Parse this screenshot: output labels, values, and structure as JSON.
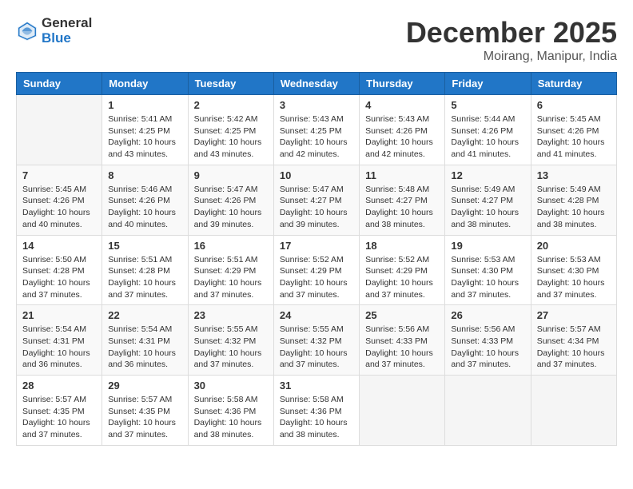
{
  "header": {
    "logo_line1": "General",
    "logo_line2": "Blue",
    "month": "December 2025",
    "location": "Moirang, Manipur, India"
  },
  "weekdays": [
    "Sunday",
    "Monday",
    "Tuesday",
    "Wednesday",
    "Thursday",
    "Friday",
    "Saturday"
  ],
  "weeks": [
    [
      {
        "day": "",
        "info": ""
      },
      {
        "day": "1",
        "info": "Sunrise: 5:41 AM\nSunset: 4:25 PM\nDaylight: 10 hours\nand 43 minutes."
      },
      {
        "day": "2",
        "info": "Sunrise: 5:42 AM\nSunset: 4:25 PM\nDaylight: 10 hours\nand 43 minutes."
      },
      {
        "day": "3",
        "info": "Sunrise: 5:43 AM\nSunset: 4:25 PM\nDaylight: 10 hours\nand 42 minutes."
      },
      {
        "day": "4",
        "info": "Sunrise: 5:43 AM\nSunset: 4:26 PM\nDaylight: 10 hours\nand 42 minutes."
      },
      {
        "day": "5",
        "info": "Sunrise: 5:44 AM\nSunset: 4:26 PM\nDaylight: 10 hours\nand 41 minutes."
      },
      {
        "day": "6",
        "info": "Sunrise: 5:45 AM\nSunset: 4:26 PM\nDaylight: 10 hours\nand 41 minutes."
      }
    ],
    [
      {
        "day": "7",
        "info": "Sunrise: 5:45 AM\nSunset: 4:26 PM\nDaylight: 10 hours\nand 40 minutes."
      },
      {
        "day": "8",
        "info": "Sunrise: 5:46 AM\nSunset: 4:26 PM\nDaylight: 10 hours\nand 40 minutes."
      },
      {
        "day": "9",
        "info": "Sunrise: 5:47 AM\nSunset: 4:26 PM\nDaylight: 10 hours\nand 39 minutes."
      },
      {
        "day": "10",
        "info": "Sunrise: 5:47 AM\nSunset: 4:27 PM\nDaylight: 10 hours\nand 39 minutes."
      },
      {
        "day": "11",
        "info": "Sunrise: 5:48 AM\nSunset: 4:27 PM\nDaylight: 10 hours\nand 38 minutes."
      },
      {
        "day": "12",
        "info": "Sunrise: 5:49 AM\nSunset: 4:27 PM\nDaylight: 10 hours\nand 38 minutes."
      },
      {
        "day": "13",
        "info": "Sunrise: 5:49 AM\nSunset: 4:28 PM\nDaylight: 10 hours\nand 38 minutes."
      }
    ],
    [
      {
        "day": "14",
        "info": "Sunrise: 5:50 AM\nSunset: 4:28 PM\nDaylight: 10 hours\nand 37 minutes."
      },
      {
        "day": "15",
        "info": "Sunrise: 5:51 AM\nSunset: 4:28 PM\nDaylight: 10 hours\nand 37 minutes."
      },
      {
        "day": "16",
        "info": "Sunrise: 5:51 AM\nSunset: 4:29 PM\nDaylight: 10 hours\nand 37 minutes."
      },
      {
        "day": "17",
        "info": "Sunrise: 5:52 AM\nSunset: 4:29 PM\nDaylight: 10 hours\nand 37 minutes."
      },
      {
        "day": "18",
        "info": "Sunrise: 5:52 AM\nSunset: 4:29 PM\nDaylight: 10 hours\nand 37 minutes."
      },
      {
        "day": "19",
        "info": "Sunrise: 5:53 AM\nSunset: 4:30 PM\nDaylight: 10 hours\nand 37 minutes."
      },
      {
        "day": "20",
        "info": "Sunrise: 5:53 AM\nSunset: 4:30 PM\nDaylight: 10 hours\nand 37 minutes."
      }
    ],
    [
      {
        "day": "21",
        "info": "Sunrise: 5:54 AM\nSunset: 4:31 PM\nDaylight: 10 hours\nand 36 minutes."
      },
      {
        "day": "22",
        "info": "Sunrise: 5:54 AM\nSunset: 4:31 PM\nDaylight: 10 hours\nand 36 minutes."
      },
      {
        "day": "23",
        "info": "Sunrise: 5:55 AM\nSunset: 4:32 PM\nDaylight: 10 hours\nand 37 minutes."
      },
      {
        "day": "24",
        "info": "Sunrise: 5:55 AM\nSunset: 4:32 PM\nDaylight: 10 hours\nand 37 minutes."
      },
      {
        "day": "25",
        "info": "Sunrise: 5:56 AM\nSunset: 4:33 PM\nDaylight: 10 hours\nand 37 minutes."
      },
      {
        "day": "26",
        "info": "Sunrise: 5:56 AM\nSunset: 4:33 PM\nDaylight: 10 hours\nand 37 minutes."
      },
      {
        "day": "27",
        "info": "Sunrise: 5:57 AM\nSunset: 4:34 PM\nDaylight: 10 hours\nand 37 minutes."
      }
    ],
    [
      {
        "day": "28",
        "info": "Sunrise: 5:57 AM\nSunset: 4:35 PM\nDaylight: 10 hours\nand 37 minutes."
      },
      {
        "day": "29",
        "info": "Sunrise: 5:57 AM\nSunset: 4:35 PM\nDaylight: 10 hours\nand 37 minutes."
      },
      {
        "day": "30",
        "info": "Sunrise: 5:58 AM\nSunset: 4:36 PM\nDaylight: 10 hours\nand 38 minutes."
      },
      {
        "day": "31",
        "info": "Sunrise: 5:58 AM\nSunset: 4:36 PM\nDaylight: 10 hours\nand 38 minutes."
      },
      {
        "day": "",
        "info": ""
      },
      {
        "day": "",
        "info": ""
      },
      {
        "day": "",
        "info": ""
      }
    ]
  ]
}
